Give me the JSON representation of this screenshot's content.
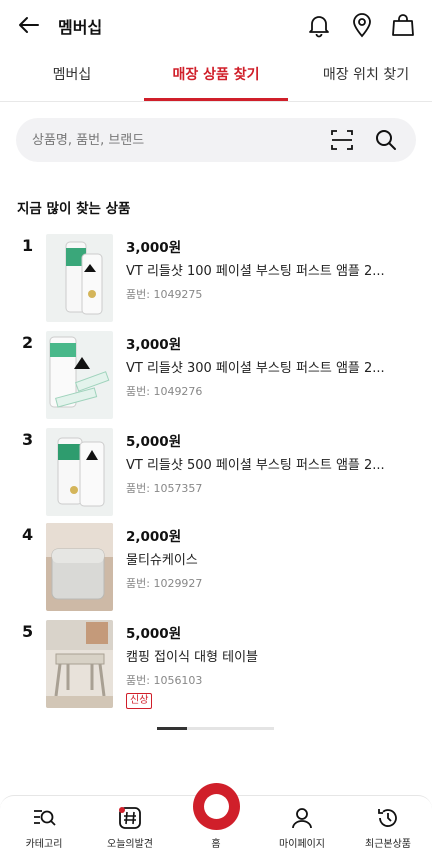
{
  "header": {
    "title": "멤버십"
  },
  "tabs": [
    "멤버십",
    "매장 상품 찾기",
    "매장 위치 찾기"
  ],
  "search": {
    "placeholder": "상품명, 품번, 브랜드"
  },
  "section_title": "지금 많이 찾는 상품",
  "products": [
    {
      "rank": "1",
      "price": "3,000원",
      "name": "VT 리들샷 100 페이셜 부스팅 퍼스트 앰플 2...",
      "code": "품번: 1049275",
      "badge": ""
    },
    {
      "rank": "2",
      "price": "3,000원",
      "name": "VT 리들샷 300 페이셜 부스팅 퍼스트 앰플 2...",
      "code": "품번: 1049276",
      "badge": ""
    },
    {
      "rank": "3",
      "price": "5,000원",
      "name": "VT 리들샷 500 페이셜 부스팅 퍼스트 앰플 2...",
      "code": "품번: 1057357",
      "badge": ""
    },
    {
      "rank": "4",
      "price": "2,000원",
      "name": "물티슈케이스",
      "code": "품번: 1029927",
      "badge": ""
    },
    {
      "rank": "5",
      "price": "5,000원",
      "name": "캠핑 접이식 대형 테이블",
      "code": "품번: 1056103",
      "badge": "신상"
    }
  ],
  "bottom_nav": [
    "카테고리",
    "오늘의발견",
    "홈",
    "마이페이지",
    "최근본상품"
  ],
  "colors": {
    "accent": "#d01f2a"
  },
  "icons": [
    "back-arrow-icon",
    "bell-icon",
    "location-pin-icon",
    "shopping-bag-icon",
    "barcode-scan-icon",
    "search-icon"
  ]
}
